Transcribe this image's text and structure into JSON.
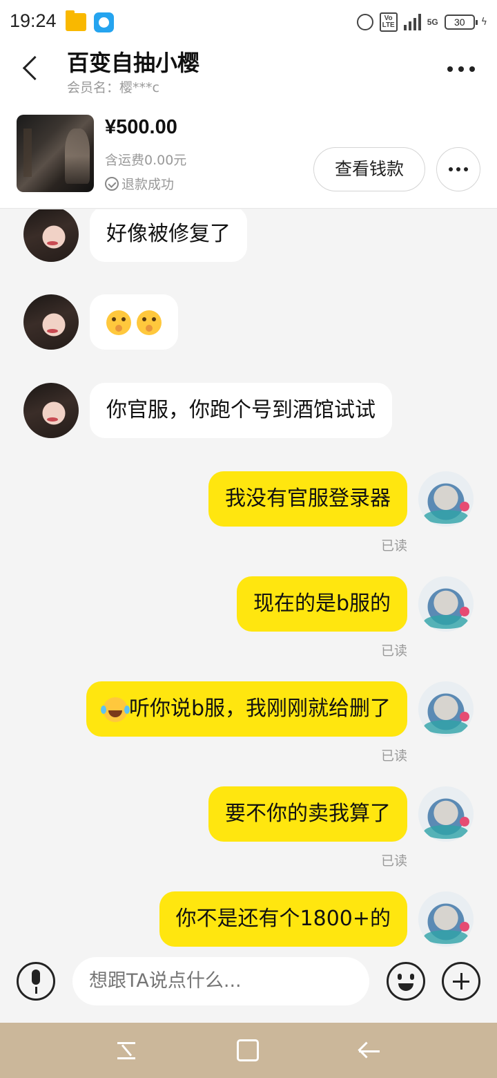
{
  "status_bar": {
    "time": "19:24",
    "volte": "Vo\nLTE",
    "network": "5G",
    "battery": "30",
    "icons": [
      "folder-icon",
      "app-icon",
      "alarm-icon",
      "volte-icon",
      "signal-icon",
      "battery-icon"
    ]
  },
  "header": {
    "title": "百变自抽小樱",
    "member": "会员名：樱***c"
  },
  "product": {
    "price": "¥500.00",
    "shipping": "含运费0.00元",
    "status": "退款成功",
    "view_money_label": "查看钱款"
  },
  "messages": [
    {
      "side": "in",
      "text": "好像被修复了"
    },
    {
      "side": "in",
      "text": "",
      "emoji": [
        "shushing-face",
        "shushing-face"
      ]
    },
    {
      "side": "in",
      "text": "你官服，你跑个号到酒馆试试"
    },
    {
      "side": "out",
      "text": "我没有官服登录器",
      "read": "已读"
    },
    {
      "side": "out",
      "text": "现在的是b服的",
      "read": "已读"
    },
    {
      "side": "out",
      "text": "听你说b服，我刚刚就给删了",
      "emoji": [
        "tears-of-joy"
      ],
      "read": "已读"
    },
    {
      "side": "out",
      "text": "要不你的卖我算了",
      "read": "已读"
    },
    {
      "side": "out",
      "text": "你不是还有个1800+的"
    }
  ],
  "input": {
    "placeholder": "想跟TA说点什么..."
  },
  "colors": {
    "outgoing_bubble": "#ffe60f",
    "incoming_bubble": "#ffffff",
    "background": "#f4f4f4",
    "nav_bar": "#cbb79a"
  }
}
